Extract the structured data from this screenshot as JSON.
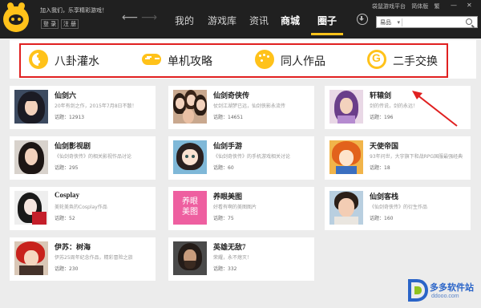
{
  "topbar": {
    "welcome_text": "加入我们，乐享精彩游戏！",
    "login_label": "登 录",
    "register_label": "注 册",
    "nav_tabs": [
      "我的",
      "游戏库",
      "资讯",
      "商城",
      "圈子"
    ],
    "active_tab": "圈子",
    "platform_links": [
      "袋鼠游戏平台",
      "简体版",
      "繁"
    ],
    "search": {
      "category": "易品",
      "placeholder": ""
    }
  },
  "categories": [
    {
      "label": "八卦灌水",
      "icon": "yinyang-icon"
    },
    {
      "label": "单机攻略",
      "icon": "gamepad-icon"
    },
    {
      "label": "同人作品",
      "icon": "palette-icon"
    },
    {
      "label": "二手交换",
      "icon": "g-coin-icon"
    }
  ],
  "cards": [
    {
      "title": "仙剑六",
      "desc": "20年有剑之作，2015年7月8日不散！",
      "topics": "话题：12913"
    },
    {
      "title": "仙剑奇侠传",
      "desc": "仗剑江湖梦已远，仙剑侠影永流传",
      "topics": "话题：14651"
    },
    {
      "title": "轩辕剑",
      "desc": "剑的传说，剑的永远！",
      "topics": "话题：196"
    },
    {
      "title": "仙剑影视剧",
      "desc": "《仙剑奇侠传》的相关影视作品讨论",
      "topics": "话题：295"
    },
    {
      "title": "仙剑手游",
      "desc": "《仙剑奇侠传》的手机游戏相关讨论",
      "topics": "话题：60"
    },
    {
      "title": "天使帝国",
      "desc": "93年问世，大宇旗下和战RPG国服最强经典",
      "topics": "话题：18"
    },
    {
      "title": "Cosplay",
      "desc": "美轮美奂的Cosplay作品",
      "topics": "话题：52"
    },
    {
      "title": "养眼美图",
      "desc": "好看有啊的美图图片",
      "topics": "话题：75"
    },
    {
      "title": "仙剑客栈",
      "desc": "《仙剑奇侠传》的衍生作品",
      "topics": "话题：160"
    },
    {
      "title": "伊苏：树海",
      "desc": "伊苏25周年纪念作品，精彩冒险之旅",
      "topics": "话题：230"
    },
    {
      "title": "英雄无敌7",
      "desc": "荣耀，永不熄灭！",
      "topics": "话题：332"
    }
  ],
  "thumb_pink_text": [
    "养眼",
    "美图"
  ],
  "watermark": {
    "title": "多多软件站",
    "url": "ddooo.com"
  },
  "colors": {
    "topbar": "#202020",
    "accent": "#ffc21a",
    "highlight": "#e02020",
    "background": "#ececec"
  }
}
